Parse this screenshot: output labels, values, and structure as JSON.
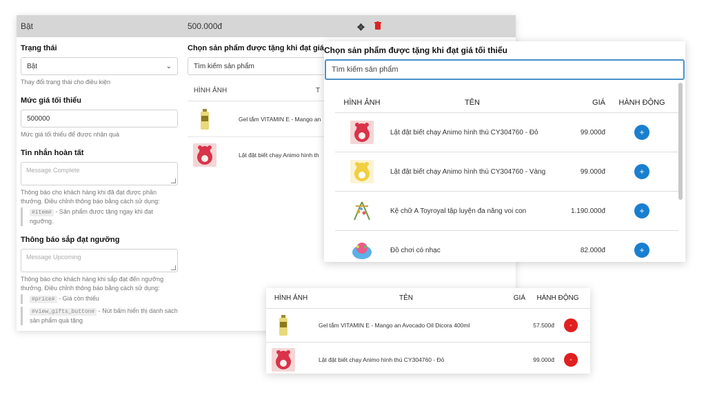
{
  "top": {
    "status": "Bật",
    "price": "500.000đ"
  },
  "form": {
    "status_label": "Trạng thái",
    "status_value": "Bật",
    "status_help": "Thay đổi trạng thái cho điều kiện",
    "min_label": "Mức giá tối thiểu",
    "min_value": "500000",
    "min_help": "Mức giá tối thiểu để được nhận quà",
    "complete_label": "Tin nhắn hoàn tất",
    "complete_placeholder": "Message Complete",
    "complete_help": "Thông báo cho khách hàng khi đã đạt được phần thưởng. Điều chỉnh thông báo bằng cách sử dụng:",
    "complete_code": "#item#",
    "complete_code_desc": " - Sản phẩm được tặng ngay khi đạt ngưỡng.",
    "upcoming_label": "Thông báo sắp đạt ngưỡng",
    "upcoming_placeholder": "Message Upcoming",
    "upcoming_help": "Thông báo cho khách hàng khi sắp đạt đến ngưỡng thưởng. Điều chỉnh thông báo bằng cách sử dụng:",
    "code1": "#price#",
    "code1_desc": " - Giá còn thiếu",
    "code2": "#view_gifts_button#",
    "code2_desc": " - Nút bấm hiển thị danh sách sản phẩm quà tặng"
  },
  "mid": {
    "title": "Chọn sản phẩm được tặng khi đạt giá tối",
    "search": "Tìm kiếm sản phẩm",
    "col_img": "HÌNH ẢNH",
    "col_name": "T",
    "rows": [
      {
        "name": "Gel tắm VITAMIN E - Mango an"
      },
      {
        "name": "Lật đật biết chạy Animo hình th"
      }
    ]
  },
  "modal": {
    "title": "Chọn sản phẩm được tặng khi đạt giá tối thiểu",
    "search_placeholder": "Tìm kiếm sản phẩm",
    "headers": {
      "img": "HÌNH ẢNH",
      "name": "TÊN",
      "price": "GIÁ",
      "action": "HÀNH ĐỘNG"
    },
    "rows": [
      {
        "name": "Lật đật biết chạy Animo hình thú CY304760 - Đỏ",
        "price": "99.000đ",
        "btn": "+"
      },
      {
        "name": "Lật đật biết chạy Animo hình thú CY304760 - Vàng",
        "price": "99.000đ",
        "btn": "+"
      },
      {
        "name": "Kệ chữ A Toyroyal tập luyện đa năng voi con",
        "price": "1.190.000đ",
        "btn": "+"
      },
      {
        "name": "Đồ chơi có nhạc",
        "price": "82.000đ",
        "btn": "+"
      }
    ]
  },
  "selected": {
    "headers": {
      "img": "HÌNH ẢNH",
      "name": "TÊN",
      "price": "GIÁ",
      "action": "HÀNH ĐỘNG"
    },
    "rows": [
      {
        "name": "Gel tắm VITAMIN E - Mango an Avocado Oil Dicora 400ml",
        "price": "57.500đ",
        "btn": "-"
      },
      {
        "name": "Lật đật biết chạy Animo hình thú CY304760 - Đỏ",
        "price": "99.000đ",
        "btn": "-"
      }
    ]
  },
  "colors": {
    "accent": "#1a7fd0",
    "danger": "#e02020",
    "topbar": "#d6d6d6"
  }
}
